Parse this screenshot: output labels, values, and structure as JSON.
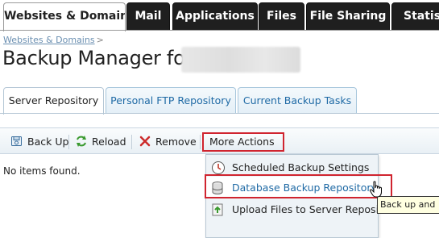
{
  "topnav": {
    "tabs": [
      {
        "label": "Websites & Domains",
        "active": true
      },
      {
        "label": "Mail",
        "active": false
      },
      {
        "label": "Applications",
        "active": false
      },
      {
        "label": "Files",
        "active": false
      },
      {
        "label": "File Sharing",
        "active": false
      },
      {
        "label": "Statistics",
        "active": false
      }
    ]
  },
  "breadcrumb": {
    "link": "Websites & Domains",
    "separator": ">"
  },
  "page": {
    "title": "Backup Manager for"
  },
  "subtabs": [
    {
      "label": "Server Repository",
      "active": true
    },
    {
      "label": "Personal FTP Repository",
      "active": false
    },
    {
      "label": "Current Backup Tasks",
      "active": false
    }
  ],
  "toolbar": {
    "backup_label": "Back Up",
    "reload_label": "Reload",
    "remove_label": "Remove",
    "more_actions_label": "More Actions"
  },
  "content": {
    "empty_message": "No items found."
  },
  "menu": {
    "items": [
      {
        "label": "Scheduled Backup Settings",
        "icon": "clock-icon"
      },
      {
        "label": "Database Backup Repository",
        "icon": "database-icon"
      },
      {
        "label": "Upload Files to Server Repository",
        "icon": "upload-icon"
      }
    ]
  },
  "tooltip": {
    "text": "Back up and"
  },
  "colors": {
    "accent": "#1f6aa5",
    "highlight": "#d0242f",
    "nav_dark": "#1f1f1f"
  }
}
